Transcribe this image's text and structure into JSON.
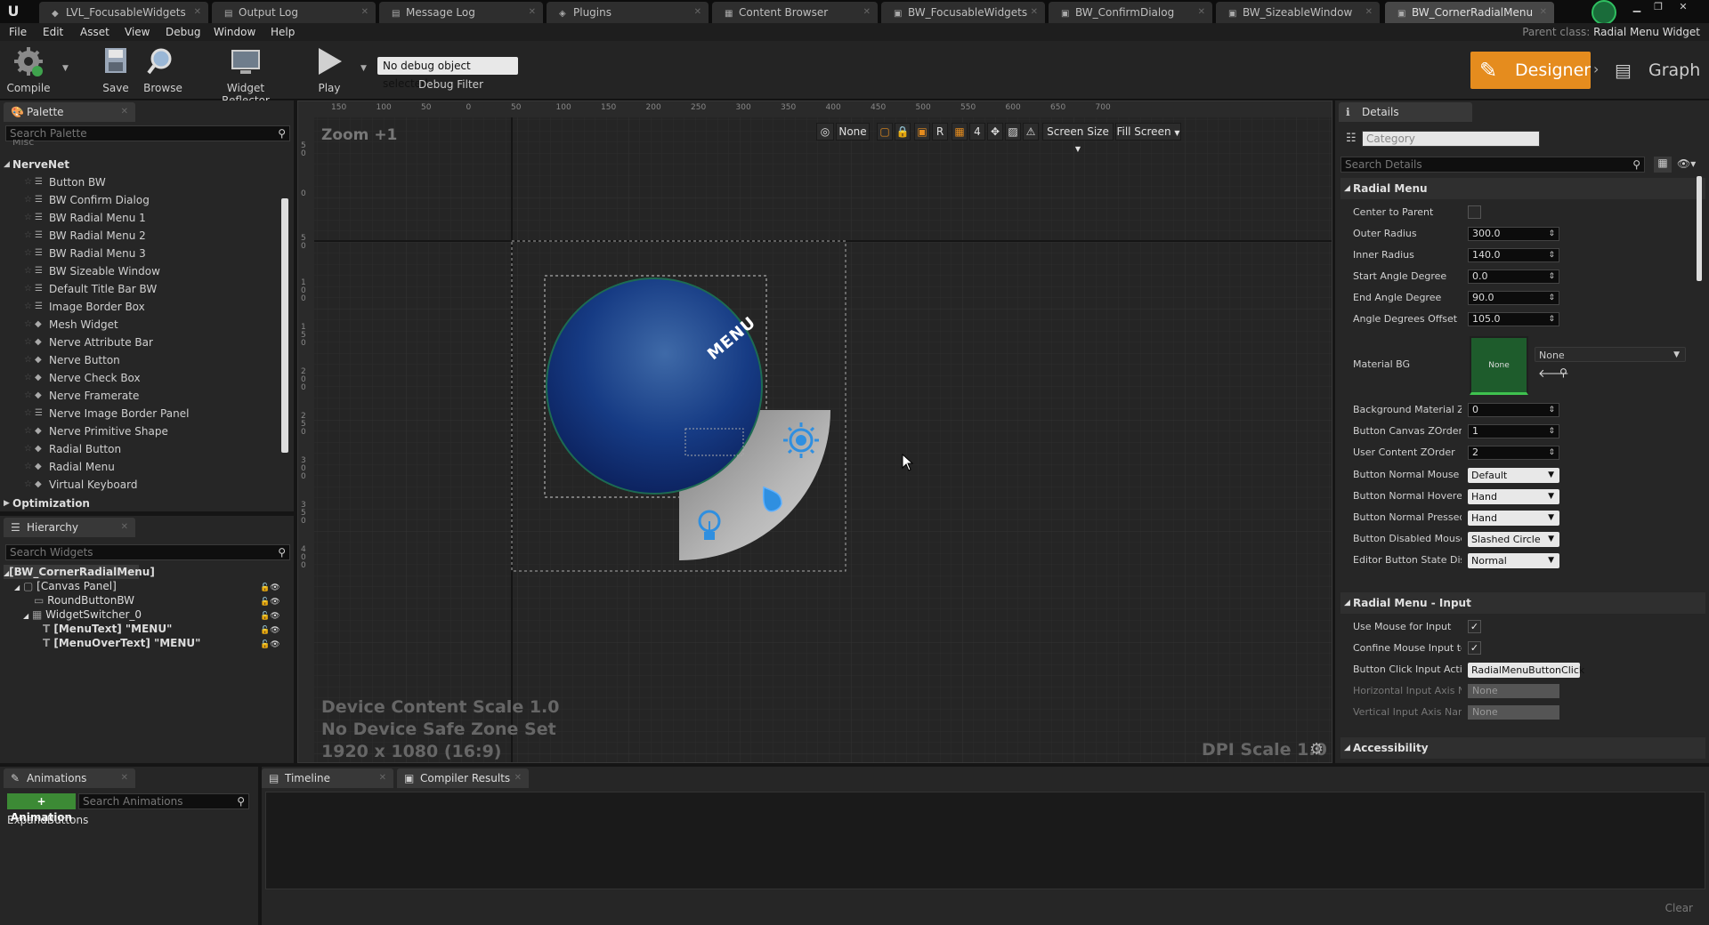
{
  "tabs": [
    {
      "label": "LVL_FocusableWidgets",
      "icon": "level-icon"
    },
    {
      "label": "Output Log",
      "icon": "output-log-icon"
    },
    {
      "label": "Message Log",
      "icon": "message-log-icon"
    },
    {
      "label": "Plugins",
      "icon": "plugin-icon"
    },
    {
      "label": "Content Browser",
      "icon": "content-browser-icon"
    },
    {
      "label": "BW_FocusableWidgets",
      "icon": "widget-blueprint-icon"
    },
    {
      "label": "BW_ConfirmDialog",
      "icon": "widget-blueprint-icon"
    },
    {
      "label": "BW_SizeableWindow",
      "icon": "widget-blueprint-icon"
    },
    {
      "label": "BW_CornerRadialMenu",
      "icon": "widget-blueprint-icon"
    }
  ],
  "menu": [
    "File",
    "Edit",
    "Asset",
    "View",
    "Debug",
    "Window",
    "Help"
  ],
  "parent_class": {
    "label": "Parent class:",
    "value": "Radial Menu Widget"
  },
  "toolbar": {
    "compile": "Compile",
    "save": "Save",
    "browse": "Browse",
    "widget_reflector": "Widget Reflector",
    "play": "Play",
    "debug_select": "No debug object selected",
    "debug_filter": "Debug Filter",
    "designer": "Designer",
    "graph": "Graph"
  },
  "palette": {
    "title": "Palette",
    "search_placeholder": "Search Palette",
    "misc_category": "Misc",
    "category": "NerveNet",
    "items": [
      "Button BW",
      "BW Confirm Dialog",
      "BW Radial Menu 1",
      "BW Radial Menu 2",
      "BW Radial Menu 3",
      "BW Sizeable Window",
      "Default Title Bar BW",
      "Image Border Box",
      "Mesh Widget",
      "Nerve Attribute Bar",
      "Nerve Button",
      "Nerve Check Box",
      "Nerve Framerate",
      "Nerve Image Border Panel",
      "Nerve Primitive Shape",
      "Radial Button",
      "Radial Menu",
      "Virtual Keyboard"
    ],
    "next_category": "Optimization"
  },
  "hierarchy": {
    "title": "Hierarchy",
    "search_placeholder": "Search Widgets",
    "root": "[BW_CornerRadialMenu]",
    "nodes": [
      "[Canvas Panel]",
      "RoundButtonBW",
      "WidgetSwitcher_0",
      "[MenuText] \"MENU\"",
      "[MenuOverText] \"MENU\""
    ]
  },
  "viewport": {
    "zoom": "Zoom +1",
    "ruler_top": [
      "150",
      "100",
      "50",
      "0",
      "50",
      "100",
      "150",
      "200",
      "250",
      "300",
      "350",
      "400",
      "450",
      "500",
      "550",
      "600",
      "650",
      "700"
    ],
    "ruler_left": [
      "5 0",
      "0",
      "5 0",
      "1 0 0",
      "1 5 0",
      "2 0 0",
      "2 5 0",
      "3 0 0",
      "3 5 0",
      "4 0 0"
    ],
    "localization": "None",
    "r_button": "R",
    "grid_snap": "4",
    "screen_size": "Screen Size",
    "fill_screen": "Fill Screen",
    "menu_text": "MENU",
    "device_scale": "Device Content Scale 1.0",
    "safe_zone": "No Device Safe Zone Set",
    "resolution": "1920 x 1080 (16:9)",
    "dpi_scale": "DPI Scale 1.0"
  },
  "details": {
    "title": "Details",
    "category_placeholder": "Category",
    "search_placeholder": "Search Details",
    "section1": "Radial Menu",
    "rows": [
      {
        "label": "Center to Parent",
        "type": "check",
        "value": ""
      },
      {
        "label": "Outer Radius",
        "type": "num",
        "value": "300.0"
      },
      {
        "label": "Inner Radius",
        "type": "num",
        "value": "140.0"
      },
      {
        "label": "Start Angle Degree",
        "type": "num",
        "value": "0.0"
      },
      {
        "label": "End Angle Degree",
        "type": "num",
        "value": "90.0"
      },
      {
        "label": "Angle Degrees Offset",
        "type": "num",
        "value": "105.0"
      }
    ],
    "material_bg": {
      "label": "Material BG",
      "thumb": "None",
      "value": "None"
    },
    "rows2": [
      {
        "label": "Background Material ZOrder",
        "type": "num",
        "value": "0"
      },
      {
        "label": "Button Canvas ZOrder",
        "type": "num",
        "value": "1"
      },
      {
        "label": "User Content ZOrder",
        "type": "num",
        "value": "2"
      },
      {
        "label": "Button Normal Mouse Cursor",
        "type": "drop",
        "value": "Default"
      },
      {
        "label": "Button Normal Hovered Mouse Cursor",
        "type": "drop",
        "value": "Hand"
      },
      {
        "label": "Button Normal Pressed Mouse Cursor",
        "type": "drop",
        "value": "Hand"
      },
      {
        "label": "Button Disabled Mouse Cursor",
        "type": "drop",
        "value": "Slashed Circle"
      },
      {
        "label": "Editor Button State Display",
        "type": "drop",
        "value": "Normal"
      }
    ],
    "section2": "Radial Menu - Input",
    "rows3": [
      {
        "label": "Use Mouse for Input",
        "type": "check",
        "value": "✓"
      },
      {
        "label": "Confine Mouse Input to Inner Radius",
        "type": "check",
        "value": "✓"
      },
      {
        "label": "Button Click Input Action",
        "type": "text",
        "value": "RadialMenuButtonClick"
      },
      {
        "label": "Horizontal Input Axis Name",
        "type": "disabled",
        "value": "None"
      },
      {
        "label": "Vertical Input Axis Name",
        "type": "disabled",
        "value": "None"
      }
    ],
    "section3": "Accessibility"
  },
  "animations": {
    "title": "Animations",
    "add_button": "+ Animation",
    "search_placeholder": "Search Animations",
    "items": [
      "ExpandButtons"
    ]
  },
  "bottom_tabs": {
    "timeline": "Timeline",
    "compiler_results": "Compiler Results",
    "clear": "Clear"
  },
  "colors": {
    "accent": "#e58c1e",
    "selection": "#0070e0",
    "canvas_bg": "#252525"
  }
}
